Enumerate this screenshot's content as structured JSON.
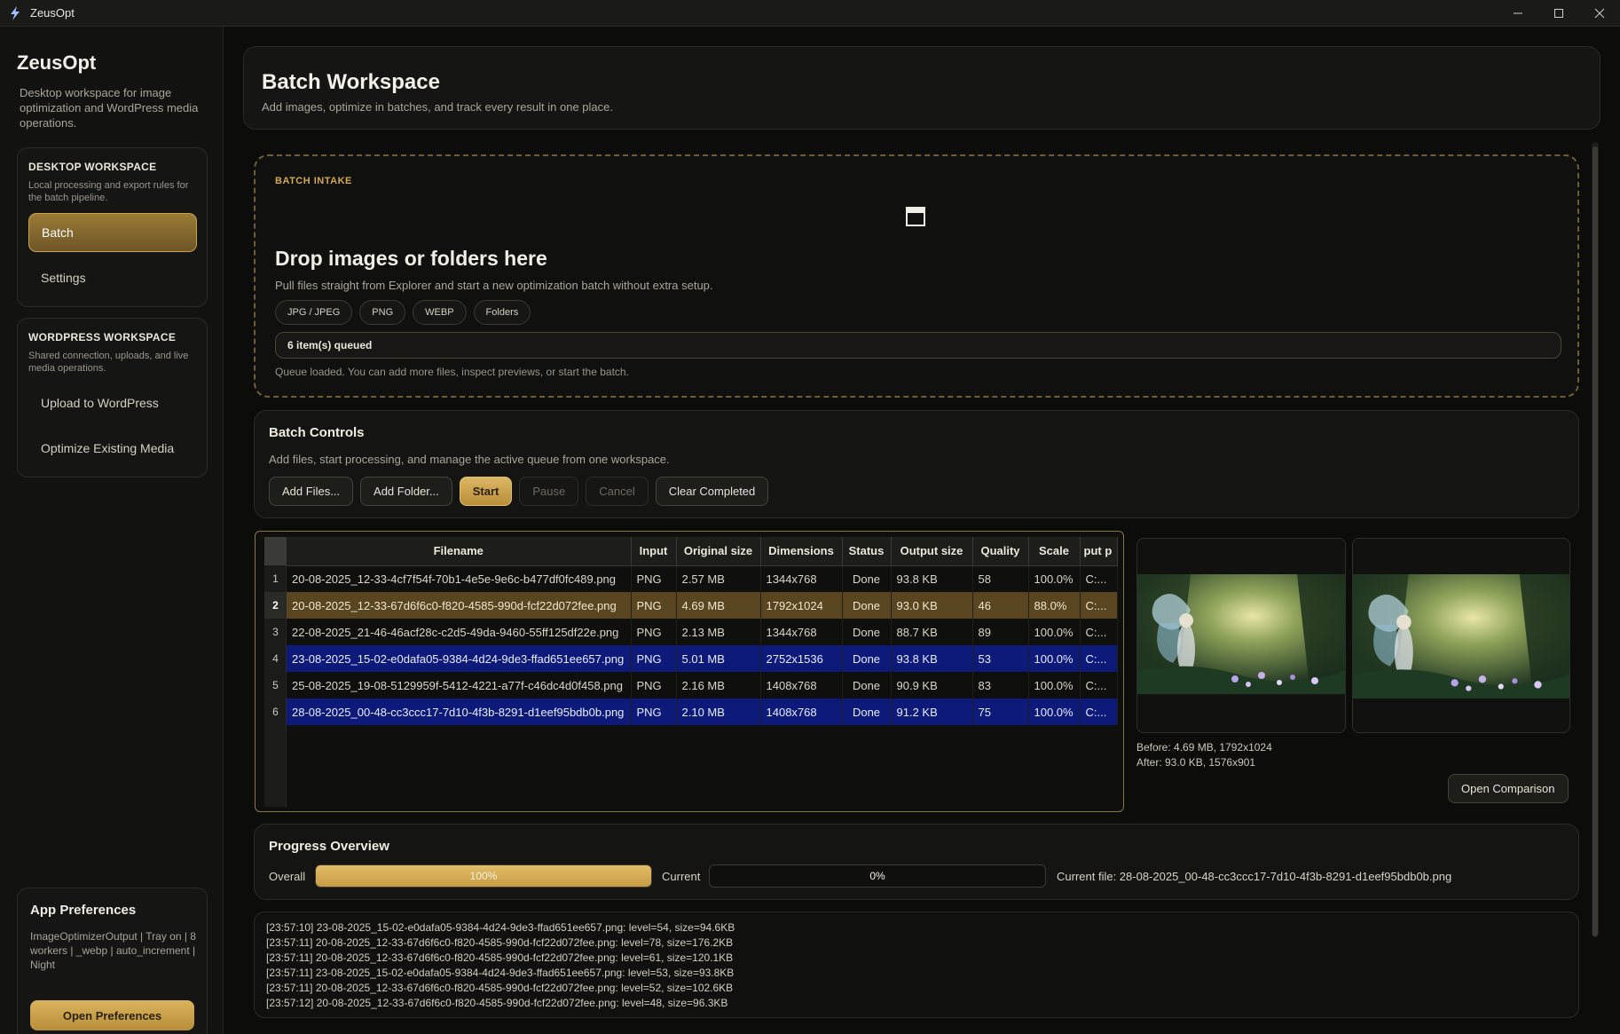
{
  "window": {
    "title": "ZeusOpt",
    "controls": {
      "minimize": "–",
      "maximize": "☐",
      "close": "✕"
    }
  },
  "sidebar": {
    "brand": "ZeusOpt",
    "description": "Desktop workspace for image optimization and WordPress media operations.",
    "desktop_section": {
      "title": "DESKTOP WORKSPACE",
      "description": "Local processing and export rules for the batch pipeline.",
      "items": [
        {
          "label": "Batch",
          "active": true
        },
        {
          "label": "Settings",
          "active": false
        }
      ]
    },
    "wordpress_section": {
      "title": "WORDPRESS WORKSPACE",
      "description": "Shared connection, uploads, and live media operations.",
      "items": [
        {
          "label": "Upload to WordPress"
        },
        {
          "label": "Optimize Existing Media"
        }
      ]
    },
    "preferences": {
      "title": "App Preferences",
      "summary": "ImageOptimizerOutput | Tray on | 8 workers | _webp | auto_increment | Night",
      "button": "Open Preferences"
    }
  },
  "header": {
    "title": "Batch Workspace",
    "subtitle": "Add images, optimize in batches, and track every result in one place."
  },
  "intake": {
    "eyebrow": "BATCH INTAKE",
    "drop_icon": "image-drop-icon",
    "title": "Drop images or folders here",
    "subtitle": "Pull files straight from Explorer and start a new optimization batch without extra setup.",
    "formats": [
      "JPG / JPEG",
      "PNG",
      "WEBP",
      "Folders"
    ],
    "queue_status": "6 item(s) queued",
    "note": "Queue loaded. You can add more files, inspect previews, or start the batch."
  },
  "controls": {
    "title": "Batch Controls",
    "subtitle": "Add files, start processing, and manage the active queue from one workspace.",
    "buttons": {
      "add_files": "Add Files...",
      "add_folder": "Add Folder...",
      "start": "Start",
      "pause": "Pause",
      "cancel": "Cancel",
      "clear_completed": "Clear Completed"
    }
  },
  "table": {
    "columns": [
      "Filename",
      "Input",
      "Original size",
      "Dimensions",
      "Status",
      "Output size",
      "Quality",
      "Scale",
      "put p"
    ],
    "rows": [
      {
        "num": "1",
        "filename": "20-08-2025_12-33-4cf7f54f-70b1-4e5e-9e6c-b477df0fc489.png",
        "input": "PNG",
        "orig": "2.57 MB",
        "dims": "1344x768",
        "status": "Done",
        "out": "93.8 KB",
        "quality": "58",
        "scale": "100.0%",
        "path": "C:..."
      },
      {
        "num": "2",
        "filename": "20-08-2025_12-33-67d6f6c0-f820-4585-990d-fcf22d072fee.png",
        "input": "PNG",
        "orig": "4.69 MB",
        "dims": "1792x1024",
        "status": "Done",
        "out": "93.0 KB",
        "quality": "46",
        "scale": "88.0%",
        "path": "C:..."
      },
      {
        "num": "3",
        "filename": "22-08-2025_21-46-46acf28c-c2d5-49da-9460-55ff125df22e.png",
        "input": "PNG",
        "orig": "2.13 MB",
        "dims": "1344x768",
        "status": "Done",
        "out": "88.7 KB",
        "quality": "89",
        "scale": "100.0%",
        "path": "C:..."
      },
      {
        "num": "4",
        "filename": "23-08-2025_15-02-e0dafa05-9384-4d24-9de3-ffad651ee657.png",
        "input": "PNG",
        "orig": "5.01 MB",
        "dims": "2752x1536",
        "status": "Done",
        "out": "93.8 KB",
        "quality": "53",
        "scale": "100.0%",
        "path": "C:..."
      },
      {
        "num": "5",
        "filename": "25-08-2025_19-08-5129959f-5412-4221-a77f-c46dc4d0f458.png",
        "input": "PNG",
        "orig": "2.16 MB",
        "dims": "1408x768",
        "status": "Done",
        "out": "90.9 KB",
        "quality": "83",
        "scale": "100.0%",
        "path": "C:..."
      },
      {
        "num": "6",
        "filename": "28-08-2025_00-48-cc3ccc17-7d10-4f3b-8291-d1eef95bdb0b.png",
        "input": "PNG",
        "orig": "2.10 MB",
        "dims": "1408x768",
        "status": "Done",
        "out": "91.2 KB",
        "quality": "75",
        "scale": "100.0%",
        "path": "C:..."
      }
    ]
  },
  "preview": {
    "before_info": "Before: 4.69 MB, 1792x1024",
    "after_info": "After: 93.0 KB, 1576x901",
    "button": "Open Comparison"
  },
  "progress": {
    "title": "Progress Overview",
    "overall_label": "Overall",
    "overall_value": 100,
    "overall_text": "100%",
    "current_label": "Current",
    "current_value": 0,
    "current_text": "0%",
    "current_file": "Current file: 28-08-2025_00-48-cc3ccc17-7d10-4f3b-8291-d1eef95bdb0b.png"
  },
  "log": [
    "[23:57:10] 23-08-2025_15-02-e0dafa05-9384-4d24-9de3-ffad651ee657.png: level=54, size=94.6KB",
    "[23:57:11] 20-08-2025_12-33-67d6f6c0-f820-4585-990d-fcf22d072fee.png: level=78, size=176.2KB",
    "[23:57:11] 20-08-2025_12-33-67d6f6c0-f820-4585-990d-fcf22d072fee.png: level=61, size=120.1KB",
    "[23:57:11] 23-08-2025_15-02-e0dafa05-9384-4d24-9de3-ffad651ee657.png: level=53, size=93.8KB",
    "[23:57:11] 20-08-2025_12-33-67d6f6c0-f820-4585-990d-fcf22d072fee.png: level=52, size=102.6KB",
    "[23:57:12] 20-08-2025_12-33-67d6f6c0-f820-4585-990d-fcf22d072fee.png: level=48, size=96.3KB"
  ],
  "colors": {
    "accent": "#d2a94f",
    "selected_gold": "#5a4521",
    "selected_blue": "#0d1a7a"
  }
}
